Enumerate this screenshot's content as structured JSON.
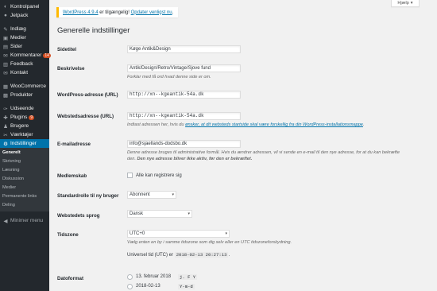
{
  "sidebar": {
    "top_items": [
      {
        "label": "Kontrolpanel",
        "icon": "dashboard-icon",
        "glyph": "◐"
      },
      {
        "label": "Jetpack",
        "icon": "jetpack-icon",
        "glyph": "●"
      }
    ],
    "mid_items": [
      {
        "label": "Indlæg",
        "icon": "pin-icon",
        "glyph": "✎"
      },
      {
        "label": "Medier",
        "icon": "media-icon",
        "glyph": "▣"
      },
      {
        "label": "Sider",
        "icon": "pages-icon",
        "glyph": "▤"
      },
      {
        "label": "Kommentarer",
        "icon": "comment-icon",
        "glyph": "✉",
        "badge": "14"
      },
      {
        "label": "Feedback",
        "icon": "feedback-icon",
        "glyph": "▥"
      },
      {
        "label": "Kontakt",
        "icon": "contact-icon",
        "glyph": "✉"
      }
    ],
    "shop_items": [
      {
        "label": "WooCommerce",
        "icon": "woocommerce-icon",
        "glyph": "▦"
      },
      {
        "label": "Produkter",
        "icon": "products-icon",
        "glyph": "▩"
      }
    ],
    "tool_items": [
      {
        "label": "Udseende",
        "icon": "appearance-icon",
        "glyph": "✑"
      },
      {
        "label": "Plugins",
        "icon": "plugins-icon",
        "glyph": "✚",
        "badge": "9"
      },
      {
        "label": "Brugere",
        "icon": "users-icon",
        "glyph": "♟"
      },
      {
        "label": "Værktøjer",
        "icon": "tools-icon",
        "glyph": "✂"
      }
    ],
    "active_item": {
      "label": "Indstillinger",
      "icon": "settings-icon",
      "glyph": "⚙"
    },
    "submenu": [
      "Generelt",
      "Skrivning",
      "Læsning",
      "Diskussion",
      "Medier",
      "Permanente links",
      "Deling"
    ],
    "collapse_label": "Minimer menu"
  },
  "help_tab": "Hjælp",
  "notice": {
    "text_pre": "WordPress 4.9.4",
    "text_mid": " er tilgængelig! ",
    "link": "Opdater venligst nu",
    "text_post": "."
  },
  "page_title": "Generelle indstillinger",
  "fields": {
    "sitetitel": {
      "label": "Sidetitel",
      "value": "Køge Antik&Design"
    },
    "beskrivelse": {
      "label": "Beskrivelse",
      "value": "Antik/Design/Retro/Vintage/Sjove fund",
      "desc": "Forklar med få ord hvad denne side er om."
    },
    "wp_url": {
      "label": "WordPress-adresse (URL)",
      "value": "http://xn--kgeantik-54a.dk"
    },
    "site_url": {
      "label": "Webstedsadresse (URL)",
      "value": "http://xn--kgeantik-54a.dk",
      "desc_pre": "Indtast adressen her, hvis du ",
      "desc_link": "ønsker, at dit websteds startside skal være forskellig fra din WordPress-installationsmappe",
      "desc_post": "."
    },
    "email": {
      "label": "E-mailadresse",
      "value": "info@sjaellands-dodsbo.dk",
      "desc1": "Denne adresse bruges til administrative formål. Hvis du ændrer adressen, vil vi sende en e-mail til den nye adresse, for at du kan bekræfte",
      "desc2_pre": "den. ",
      "desc2_bold": "Den nye adresse bliver ikke aktiv, før den er bekræftet."
    },
    "membership": {
      "label": "Medlemskab",
      "checkbox_label": "Alle kan registrere sig"
    },
    "default_role": {
      "label": "Standardrolle til ny bruger",
      "value": "Abonnent"
    },
    "language": {
      "label": "Webstedets sprog",
      "value": "Dansk"
    },
    "timezone": {
      "label": "Tidszone",
      "value": "UTC+0",
      "desc": "Vælg enten en by i samme tidszone som dig selv eller en UTC tidszoneforskydning.",
      "utc_label": "Universel tid (UTC) er",
      "utc_value": "2018-02-13 20:27:13",
      "utc_post": "."
    },
    "date_format": {
      "label": "Datoformat",
      "options": [
        {
          "label": "13. februar 2018",
          "code": "j. F Y"
        },
        {
          "label": "2018-02-13",
          "code": "Y-m-d"
        }
      ]
    }
  }
}
